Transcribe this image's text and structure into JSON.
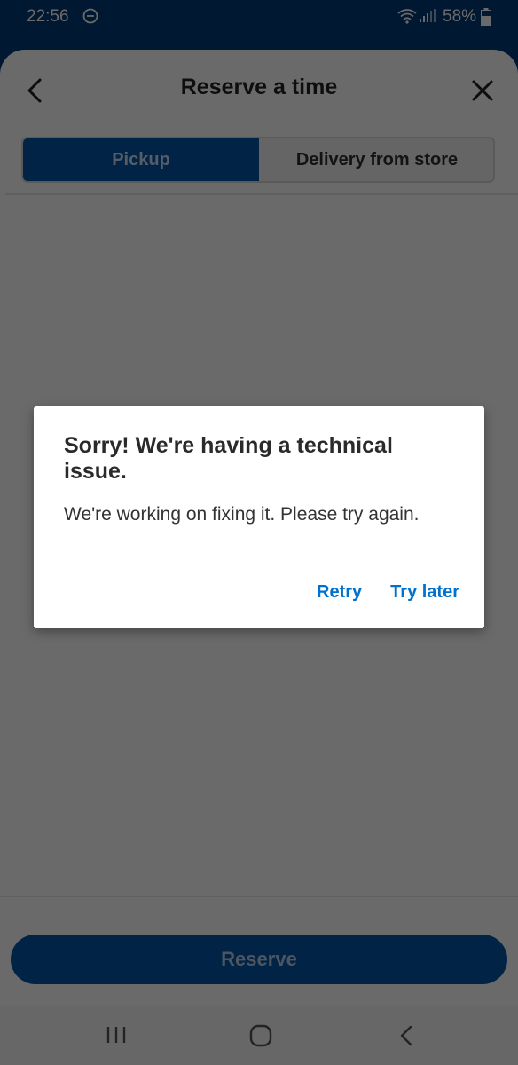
{
  "status_bar": {
    "time": "22:56",
    "battery": "58%",
    "icons": [
      "do-not-disturb-icon",
      "wifi-icon",
      "signal-icon",
      "battery-icon"
    ]
  },
  "header": {
    "title": "Reserve a time",
    "back_icon": "chevron-left-icon",
    "close_icon": "close-icon"
  },
  "tabs": [
    {
      "label": "Pickup",
      "selected": true
    },
    {
      "label": "Delivery from store",
      "selected": false
    }
  ],
  "footer": {
    "reserve_label": "Reserve"
  },
  "nav": {
    "icons": [
      "recents-icon",
      "home-icon",
      "back-icon"
    ]
  },
  "dialog": {
    "title": "Sorry! We're having a technical issue.",
    "message": "We're working on fixing it. Please try again.",
    "retry_label": "Retry",
    "later_label": "Try later"
  },
  "colors": {
    "brand_blue": "#0055a8",
    "status_bar": "#003a79",
    "link_blue": "#0071ce"
  }
}
